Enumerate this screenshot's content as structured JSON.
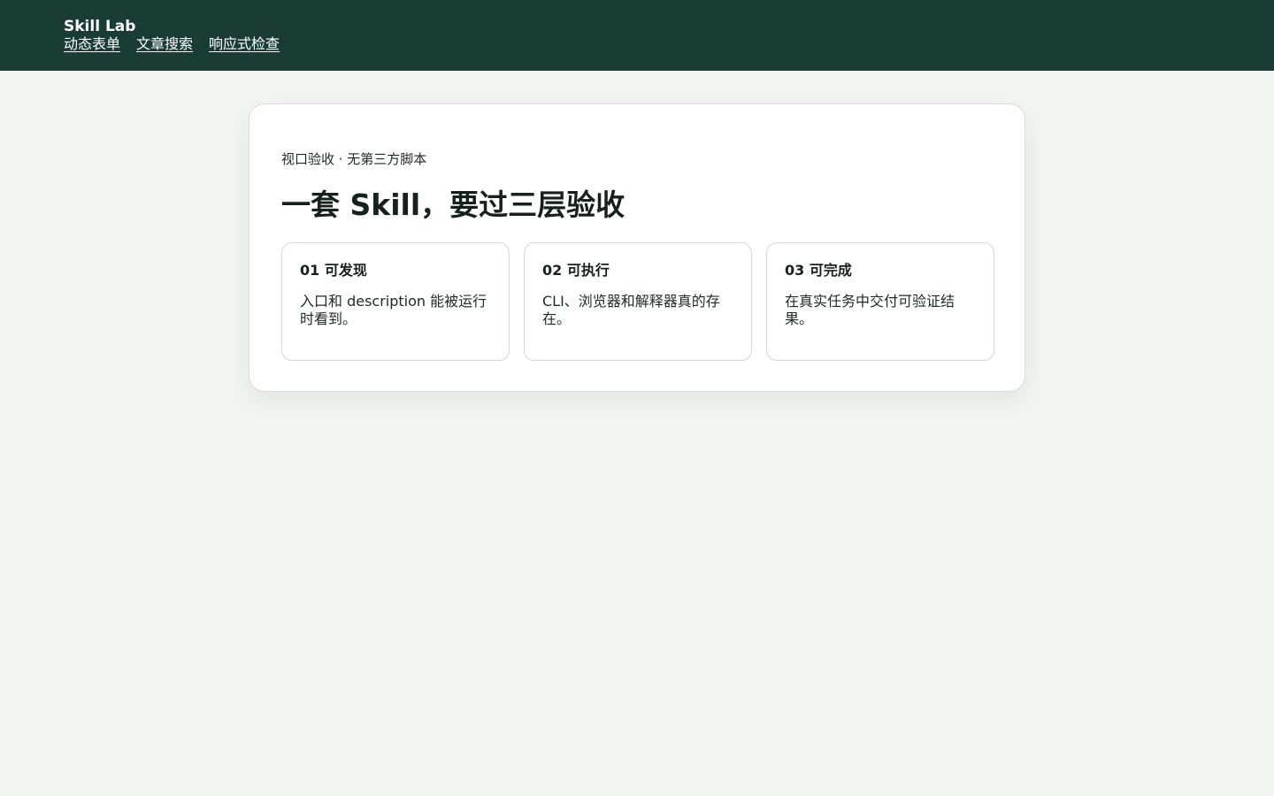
{
  "header": {
    "brand": "Skill Lab",
    "nav": [
      {
        "label": "动态表单"
      },
      {
        "label": "文章搜索"
      },
      {
        "label": "响应式检查"
      }
    ]
  },
  "main": {
    "eyebrow": "视口验收 · 无第三方脚本",
    "title": "一套 Skill，要过三层验收",
    "cards": [
      {
        "title": "01 可发现",
        "text": "入口和 description 能被运行时看到。"
      },
      {
        "title": "02 可执行",
        "text": "CLI、浏览器和解释器真的存在。"
      },
      {
        "title": "03 可完成",
        "text": "在真实任务中交付可验证结果。"
      }
    ]
  },
  "colors": {
    "header_bg": "#1a3d33",
    "page_bg": "#f3f5f2",
    "card_bg": "#ffffff",
    "text": "#17211c"
  }
}
